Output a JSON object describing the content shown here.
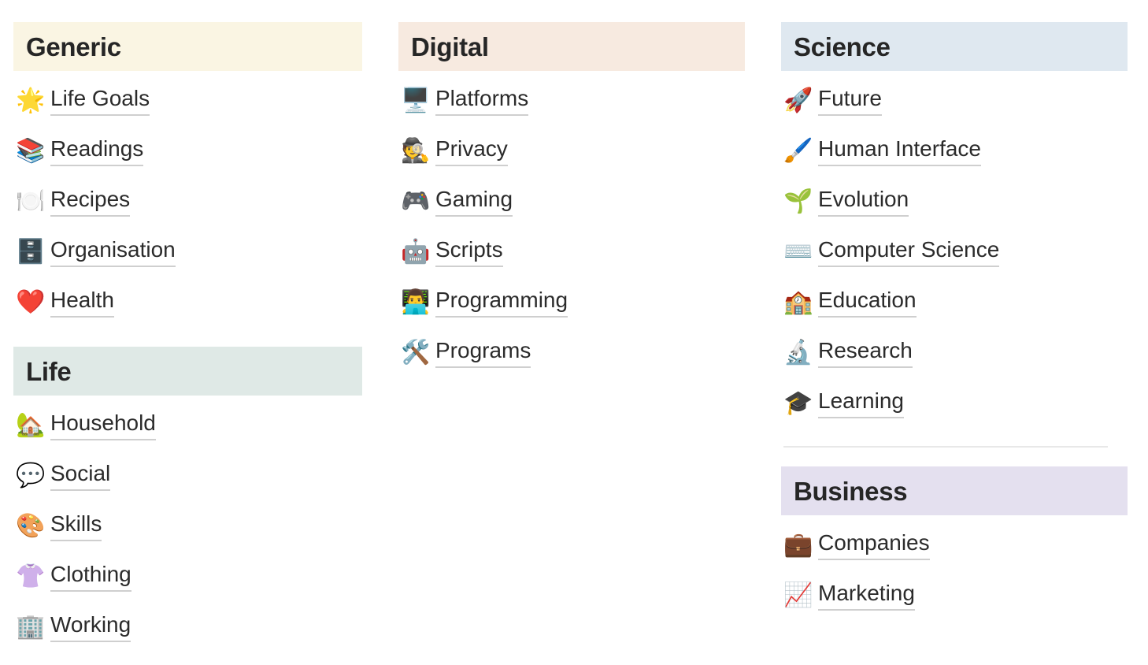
{
  "page": {
    "background": "#ffffff",
    "text_color": "#2b2b2b",
    "underline_color": "#cfcfcf",
    "divider_color": "#e8e8e8"
  },
  "columns": [
    {
      "name": "column-left",
      "sections": [
        {
          "title": "Generic",
          "header_color": "#faf5e3",
          "items": [
            {
              "emoji": "🌟",
              "icon_name": "glowing-star-icon",
              "label": "Life Goals"
            },
            {
              "emoji": "📚",
              "icon_name": "books-icon",
              "label": "Readings"
            },
            {
              "emoji": "🍽️",
              "icon_name": "fork-and-knife-with-plate-icon",
              "label": "Recipes"
            },
            {
              "emoji": "🗄️",
              "icon_name": "file-cabinet-icon",
              "label": "Organisation"
            },
            {
              "emoji": "❤️",
              "icon_name": "red-heart-icon",
              "label": "Health"
            }
          ]
        },
        {
          "title": "Life",
          "header_color": "#dfe9e6",
          "items": [
            {
              "emoji": "🏡",
              "icon_name": "house-with-garden-icon",
              "label": "Household"
            },
            {
              "emoji": "💬",
              "icon_name": "speech-balloon-icon",
              "label": "Social"
            },
            {
              "emoji": "🎨",
              "icon_name": "artist-palette-icon",
              "label": "Skills"
            },
            {
              "emoji": "👚",
              "icon_name": "womans-clothes-icon",
              "label": "Clothing"
            },
            {
              "emoji": "🏢",
              "icon_name": "office-building-icon",
              "label": "Working"
            }
          ]
        }
      ]
    },
    {
      "name": "column-middle",
      "sections": [
        {
          "title": "Digital",
          "header_color": "#f7eae0",
          "items": [
            {
              "emoji": "🖥️",
              "icon_name": "desktop-computer-icon",
              "label": "Platforms"
            },
            {
              "emoji": "🕵️",
              "icon_name": "detective-icon",
              "label": "Privacy"
            },
            {
              "emoji": "🎮",
              "icon_name": "video-game-controller-icon",
              "label": "Gaming"
            },
            {
              "emoji": "🤖",
              "icon_name": "robot-face-icon",
              "label": "Scripts"
            },
            {
              "emoji": "👨‍💻",
              "icon_name": "technologist-icon",
              "label": "Programming"
            },
            {
              "emoji": "🛠️",
              "icon_name": "hammer-and-wrench-icon",
              "label": "Programs"
            }
          ]
        }
      ]
    },
    {
      "name": "column-right",
      "sections": [
        {
          "title": "Science",
          "header_color": "#dfe8f0",
          "divider_after": true,
          "items": [
            {
              "emoji": "🚀",
              "icon_name": "rocket-icon",
              "label": "Future"
            },
            {
              "emoji": "🖌️",
              "icon_name": "paintbrush-icon",
              "label": "Human Interface"
            },
            {
              "emoji": "🌱",
              "icon_name": "seedling-icon",
              "label": "Evolution"
            },
            {
              "emoji": "⌨️",
              "icon_name": "keyboard-icon",
              "label": "Computer Science"
            },
            {
              "emoji": "🏫",
              "icon_name": "school-icon",
              "label": "Education"
            },
            {
              "emoji": "🔬",
              "icon_name": "microscope-icon",
              "label": "Research"
            },
            {
              "emoji": "🎓",
              "icon_name": "graduation-cap-icon",
              "label": "Learning"
            }
          ]
        },
        {
          "title": "Business",
          "header_color": "#e4e0ef",
          "items": [
            {
              "emoji": "💼",
              "icon_name": "briefcase-icon",
              "label": "Companies"
            },
            {
              "emoji": "📈",
              "icon_name": "chart-increasing-icon",
              "label": "Marketing"
            }
          ]
        }
      ]
    }
  ]
}
